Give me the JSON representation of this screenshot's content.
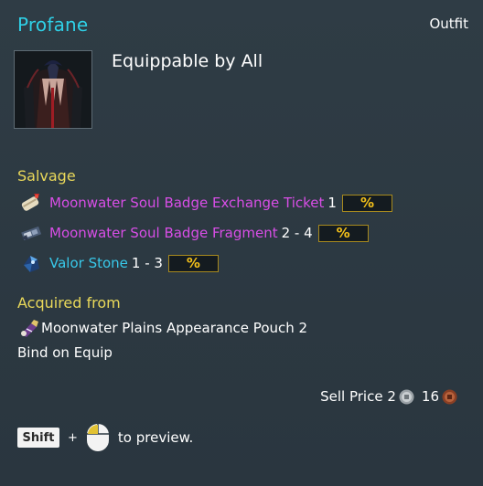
{
  "item": {
    "name": "Profane",
    "category": "Outfit",
    "equip_text": "Equippable by All"
  },
  "salvage": {
    "heading": "Salvage",
    "items": [
      {
        "name": "Moonwater Soul Badge Exchange Ticket",
        "qty": "1",
        "chance": "%",
        "icon": "scroll-ticket-icon",
        "color": "#d84ee6"
      },
      {
        "name": "Moonwater Soul Badge Fragment",
        "qty": "2 - 4",
        "chance": "%",
        "icon": "badge-fragment-icon",
        "color": "#d84ee6"
      },
      {
        "name": "Valor Stone",
        "qty": "1 - 3",
        "chance": "%",
        "icon": "valor-stone-icon",
        "color": "#38c9ea"
      }
    ]
  },
  "acquired": {
    "heading": "Acquired from",
    "source": "Moonwater Plains Appearance Pouch 2",
    "icon": "pouch-icon"
  },
  "bind": "Bind on Equip",
  "sell": {
    "label": "Sell Price",
    "silver": "2",
    "copper": "16"
  },
  "preview": {
    "key": "Shift",
    "plus": "+",
    "text": "to preview."
  },
  "colors": {
    "title": "#2fd0e6",
    "heading": "#e9d85a",
    "epic": "#d84ee6",
    "rare": "#38c9ea",
    "chance": "#f4c11a",
    "background": "#2d3a43"
  }
}
